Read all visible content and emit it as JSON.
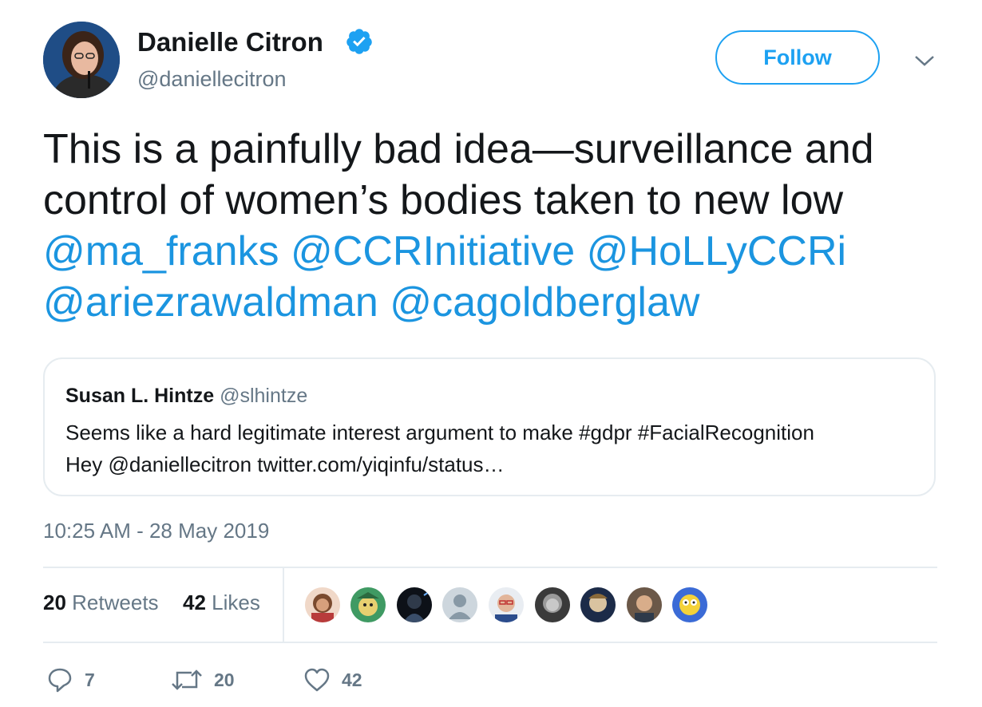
{
  "author": {
    "name": "Danielle Citron",
    "handle": "@daniellecitron",
    "verified_icon": "verified-badge-icon",
    "accent": "#1da1f2"
  },
  "follow_button": {
    "label": "Follow"
  },
  "menu_icon": "chevron-down-icon",
  "tweet": {
    "text_line1": "This is a painfully bad idea—surveillance and",
    "text_line2": "control of women’s bodies taken to new low",
    "mentions": [
      "@ma_franks",
      "@CCRInitiative",
      "@HoLLyCCRi",
      "@ariezrawaldman",
      "@cagoldberglaw"
    ]
  },
  "quoted": {
    "name": "Susan L. Hintze",
    "handle": "@slhintze",
    "line1": "Seems like a hard legitimate interest argument to make #gdpr #FacialRecognition",
    "line2": "Hey @daniellecitron twitter.com/yiqinfu/status…"
  },
  "timestamp": "10:25 AM - 28 May 2019",
  "stats": {
    "retweets_count": "20",
    "retweets_label": "Retweets",
    "likes_count": "42",
    "likes_label": "Likes"
  },
  "actions": {
    "reply_count": "7",
    "retweet_count": "20",
    "like_count": "42"
  }
}
